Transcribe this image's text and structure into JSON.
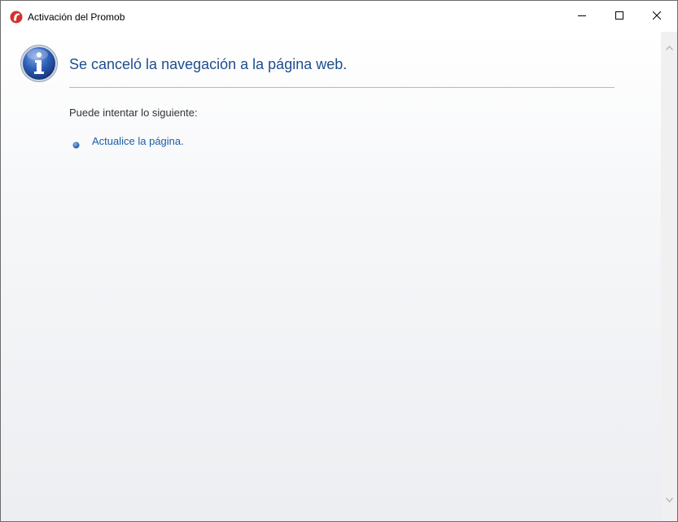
{
  "window": {
    "title": "Activación del Promob",
    "app_icon": "promob-logo-icon",
    "controls": {
      "minimize_icon": "minimize-icon",
      "maximize_icon": "maximize-icon",
      "close_icon": "close-icon"
    }
  },
  "page": {
    "icon": "info-icon",
    "heading": "Se canceló la navegación a la página web.",
    "subtext": "Puede intentar lo siguiente:",
    "suggestions": [
      {
        "label": "Actualice la página.",
        "bullet_icon": "bullet-icon"
      }
    ]
  },
  "scrollbar": {
    "up_icon": "chevron-up-icon",
    "down_icon": "chevron-down-icon"
  },
  "colors": {
    "heading": "#1e4e8c",
    "link": "#1a5fa8",
    "app_icon_red": "#d92d2d",
    "info_blue": "#2a5db0"
  }
}
